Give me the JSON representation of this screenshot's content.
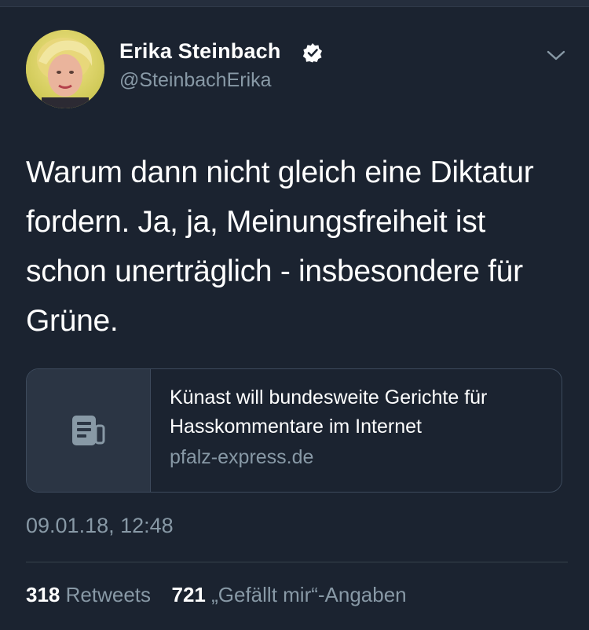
{
  "tweet": {
    "author": {
      "name": "Erika Steinbach",
      "handle": "@SteinbachErika",
      "verified": true,
      "avatar_icon": "profile-photo"
    },
    "text": "Warum dann nicht gleich eine Diktatur fordern. Ja, ja, Meinungsfreiheit ist schon unerträglich - insbesondere für Grüne.",
    "link_card": {
      "title": "Künast will bundesweite Gerichte für Hasskommentare im Internet",
      "domain": "pfalz-express.de",
      "thumbnail_icon": "article-icon"
    },
    "timestamp": "09.01.18, 12:48",
    "stats": {
      "retweets_count": "318",
      "retweets_label": "Retweets",
      "likes_count": "721",
      "likes_label": "„Gefällt mir“-Angaben"
    }
  },
  "colors": {
    "background": "#1b2330",
    "secondary_text": "#8899a6",
    "card_border": "#3d4a5c",
    "card_thumb_bg": "#2b3544"
  }
}
